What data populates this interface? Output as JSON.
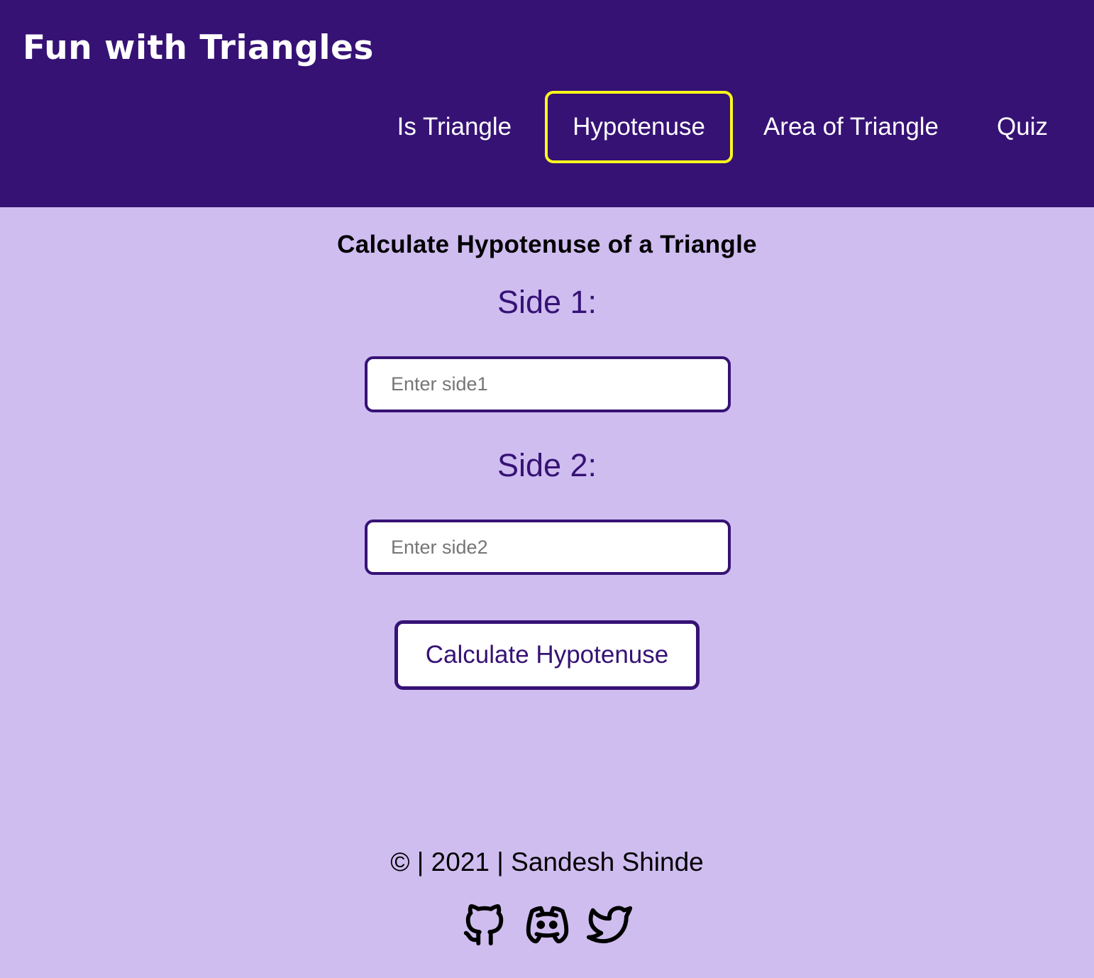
{
  "header": {
    "brand": "Fun with Triangles",
    "nav": [
      {
        "label": "Is Triangle",
        "active": false
      },
      {
        "label": "Hypotenuse",
        "active": true
      },
      {
        "label": "Area of Triangle",
        "active": false
      },
      {
        "label": "Quiz",
        "active": false
      }
    ]
  },
  "main": {
    "heading": "Calculate Hypotenuse of a Triangle",
    "side1": {
      "label": "Side 1:",
      "placeholder": "Enter side1",
      "value": ""
    },
    "side2": {
      "label": "Side 2:",
      "placeholder": "Enter side2",
      "value": ""
    },
    "button_label": "Calculate Hypotenuse"
  },
  "footer": {
    "text": "© | 2021 | Sandesh Shinde",
    "social_icons": [
      "github-icon",
      "discord-icon",
      "twitter-icon"
    ]
  },
  "colors": {
    "header_bg": "#361275",
    "page_bg": "#cfbdf0",
    "active_nav_border": "#fff81a",
    "accent": "#361275"
  }
}
